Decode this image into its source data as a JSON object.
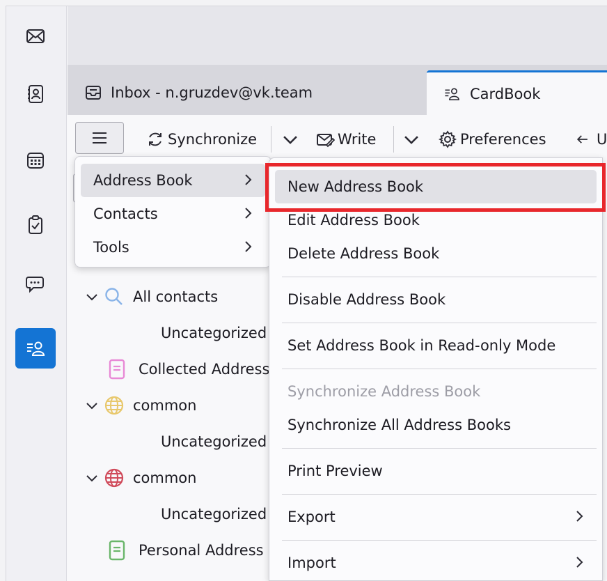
{
  "spaces": {
    "items": [
      {
        "icon": "mail-icon"
      },
      {
        "icon": "address-book-icon"
      },
      {
        "icon": "calendar-icon"
      },
      {
        "icon": "tasks-icon"
      },
      {
        "icon": "chat-icon"
      },
      {
        "icon": "cardbook-icon",
        "active": true
      }
    ]
  },
  "tabs": [
    {
      "label": "Inbox - n.gruzdev@vk.team",
      "icon": "inbox-icon"
    },
    {
      "label": "CardBook",
      "icon": "cardbook-icon"
    }
  ],
  "toolbar": {
    "synchronize": "Synchronize",
    "write": "Write",
    "preferences": "Preferences",
    "undo_partial": "U"
  },
  "tree": {
    "items": [
      {
        "label": "All contacts",
        "icon": "search-icon",
        "icon_color": "#8ab4e8"
      },
      {
        "label": "Uncategorized"
      },
      {
        "label": "Collected Address",
        "icon": "book-icon",
        "icon_color": "#e889d6"
      },
      {
        "label": "common",
        "icon": "globe-icon",
        "icon_color": "#e8c86c"
      },
      {
        "label": "Uncategorized"
      },
      {
        "label": "common",
        "icon": "globe-icon",
        "icon_color": "#d04a5a"
      },
      {
        "label": "Uncategorized"
      },
      {
        "label": "Personal Address",
        "icon": "book-icon",
        "icon_color": "#6ab66a"
      }
    ]
  },
  "menu_main": {
    "items": [
      {
        "label": "Address Book"
      },
      {
        "label": "Contacts"
      },
      {
        "label": "Tools"
      }
    ]
  },
  "menu_address_book": {
    "items": [
      {
        "label": "New Address Book"
      },
      {
        "label": "Edit Address Book"
      },
      {
        "label": "Delete Address Book"
      },
      {
        "label": "Disable Address Book"
      },
      {
        "label": "Set Address Book in Read-only Mode"
      },
      {
        "label": "Synchronize Address Book",
        "disabled": true
      },
      {
        "label": "Synchronize All Address Books"
      },
      {
        "label": "Print Preview"
      },
      {
        "label": "Export"
      },
      {
        "label": "Import"
      }
    ]
  },
  "colors": {
    "accent": "#1474d4",
    "highlight_box": "#e8272c"
  }
}
